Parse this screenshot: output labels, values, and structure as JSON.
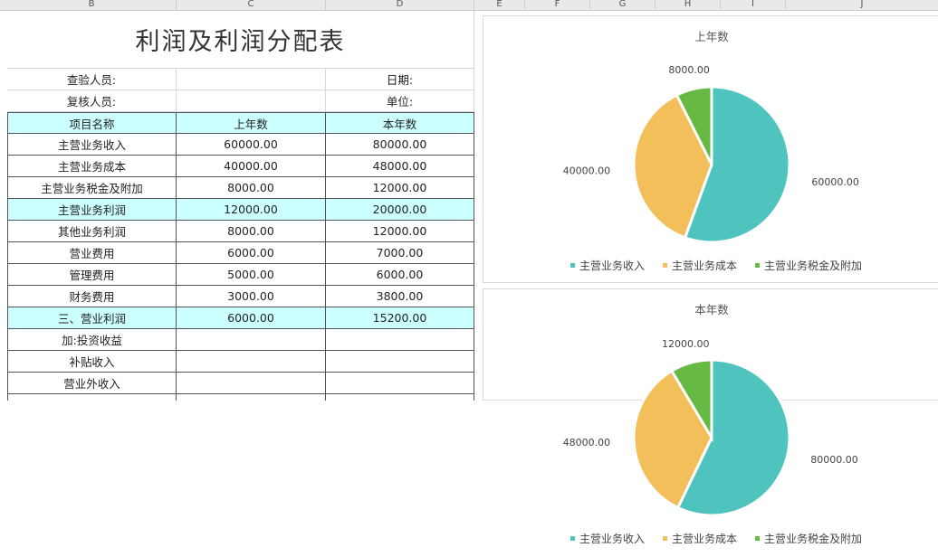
{
  "column_headers": [
    "B",
    "C",
    "D",
    "E",
    "F",
    "G",
    "H",
    "I",
    "J"
  ],
  "sheet": {
    "title": "利润及利润分配表",
    "info_rows": [
      {
        "label": "查验人员:",
        "right_label": "日期:"
      },
      {
        "label": "复核人员:",
        "right_label": "单位:"
      }
    ],
    "table_header": [
      "项目名称",
      "上年数",
      "本年数"
    ],
    "rows": [
      {
        "name": "主营业务收入",
        "prev": "60000.00",
        "curr": "80000.00",
        "highlight": false
      },
      {
        "name": "主营业务成本",
        "prev": "40000.00",
        "curr": "48000.00",
        "highlight": false
      },
      {
        "name": "主营业务税金及附加",
        "prev": "8000.00",
        "curr": "12000.00",
        "highlight": false
      },
      {
        "name": "主营业务利润",
        "prev": "12000.00",
        "curr": "20000.00",
        "highlight": true
      },
      {
        "name": "其他业务利润",
        "prev": "8000.00",
        "curr": "12000.00",
        "highlight": false
      },
      {
        "name": "营业费用",
        "prev": "6000.00",
        "curr": "7000.00",
        "highlight": false
      },
      {
        "name": "管理费用",
        "prev": "5000.00",
        "curr": "6000.00",
        "highlight": false
      },
      {
        "name": "财务费用",
        "prev": "3000.00",
        "curr": "3800.00",
        "highlight": false
      },
      {
        "name": "三、营业利润",
        "prev": "6000.00",
        "curr": "15200.00",
        "highlight": true
      },
      {
        "name": "加:投资收益",
        "prev": "",
        "curr": "",
        "highlight": false
      },
      {
        "name": "补贴收入",
        "prev": "",
        "curr": "",
        "highlight": false
      },
      {
        "name": "营业外收入",
        "prev": "",
        "curr": "",
        "highlight": false
      }
    ],
    "colors": {
      "header_fill": "#ccffff",
      "border": "#555555"
    }
  },
  "chart_data": [
    {
      "type": "pie",
      "title": "上年数",
      "categories": [
        "主营业务收入",
        "主营业务成本",
        "主营业务税金及附加"
      ],
      "values": [
        60000,
        40000,
        8000
      ],
      "data_labels": [
        "60000.00",
        "40000.00",
        "8000.00"
      ],
      "colors": [
        "#4fc3bd",
        "#f3bf5a",
        "#66b943"
      ],
      "legend_position": "bottom"
    },
    {
      "type": "pie",
      "title": "本年数",
      "categories": [
        "主营业务收入",
        "主营业务成本",
        "主营业务税金及附加"
      ],
      "values": [
        80000,
        48000,
        12000
      ],
      "data_labels": [
        "80000.00",
        "48000.00",
        "12000.00"
      ],
      "colors": [
        "#4fc3bd",
        "#f3bf5a",
        "#66b943"
      ],
      "legend_position": "bottom"
    }
  ]
}
